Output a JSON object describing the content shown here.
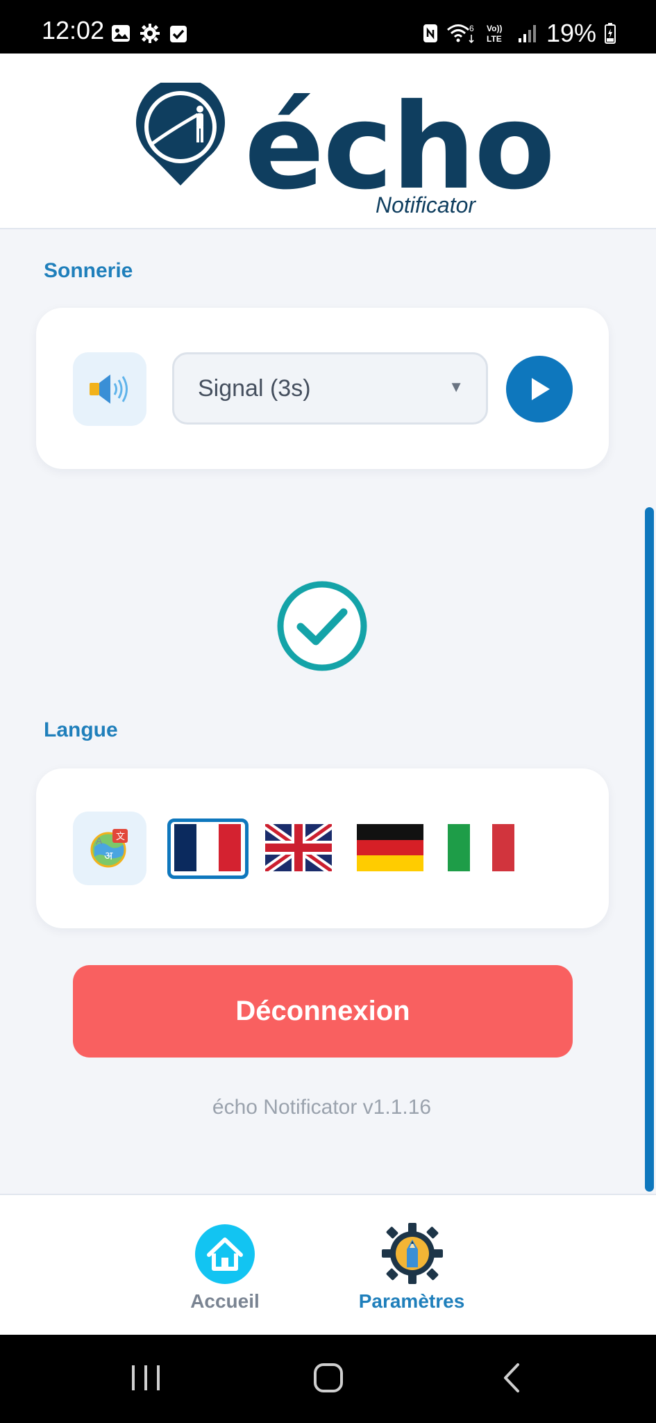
{
  "status_bar": {
    "time": "12:02",
    "battery": "19%",
    "left_icons": [
      "image-icon",
      "gear-icon",
      "checkbox-icon"
    ],
    "right_icons": [
      "nfc-icon",
      "wifi-icon",
      "volte-icon",
      "signal-icon",
      "battery-icon"
    ]
  },
  "header": {
    "logo_word": "écho",
    "logo_sub": "Notificator"
  },
  "sonnerie": {
    "title": "Sonnerie",
    "selected": "Signal (3s)",
    "caret": "▼"
  },
  "langue": {
    "title": "Langue",
    "flags": [
      "fr-flag-icon",
      "uk-flag-icon",
      "de-flag-icon",
      "it-flag-icon"
    ],
    "selected": "fr-flag-icon"
  },
  "logout": {
    "label": "Déconnexion"
  },
  "version": "écho Notificator v1.1.16",
  "bottom_nav": {
    "home_label": "Accueil",
    "settings_label": "Paramètres"
  },
  "colors": {
    "primary": "#0e77bd",
    "brand_dark": "#0f3e5f",
    "danger": "#f96060",
    "teal": "#14a3a8",
    "background": "#f3f5f9"
  }
}
